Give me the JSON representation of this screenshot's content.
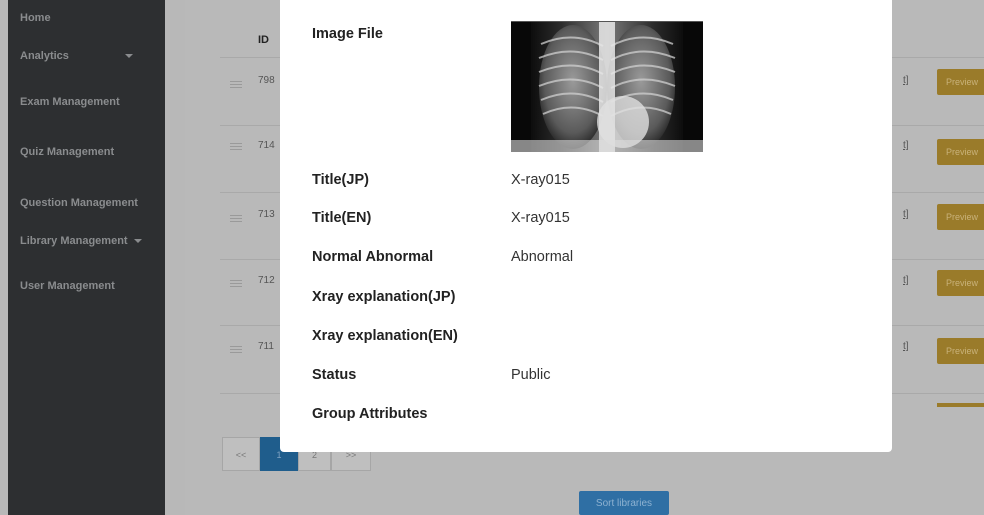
{
  "sidebar": {
    "items": [
      {
        "label": "Home"
      },
      {
        "label": "Analytics"
      },
      {
        "label": "Exam Management"
      },
      {
        "label": "Quiz Management"
      },
      {
        "label": "Question Management"
      },
      {
        "label": "Library Management"
      },
      {
        "label": "User Management"
      }
    ]
  },
  "table": {
    "id_header": "ID",
    "rows": [
      {
        "id": "798",
        "link": "t]",
        "action": "Preview"
      },
      {
        "id": "714",
        "link": "t]",
        "action": "Preview"
      },
      {
        "id": "713",
        "link": "t]",
        "action": "Preview"
      },
      {
        "id": "712",
        "link": "t]",
        "action": "Preview"
      },
      {
        "id": "711",
        "link": "t]",
        "action": "Preview"
      }
    ]
  },
  "pagination": {
    "first": "<<",
    "page1": "1",
    "page2": "2",
    "last": ">>"
  },
  "sort_button": "Sort libraries",
  "modal": {
    "image_label": "Image File",
    "fields": [
      {
        "label": "Title(JP)",
        "value": "X-ray015"
      },
      {
        "label": "Title(EN)",
        "value": "X-ray015"
      },
      {
        "label": "Normal Abnormal",
        "value": "Abnormal"
      },
      {
        "label": "Xray explanation(JP)",
        "value": ""
      },
      {
        "label": "Xray explanation(EN)",
        "value": ""
      },
      {
        "label": "Status",
        "value": "Public"
      },
      {
        "label": "Group Attributes",
        "value": ""
      }
    ]
  },
  "colors": {
    "sidebar": "#2d2f31",
    "preview_button": "#9a7b2a",
    "primary": "#2f6fa4"
  }
}
